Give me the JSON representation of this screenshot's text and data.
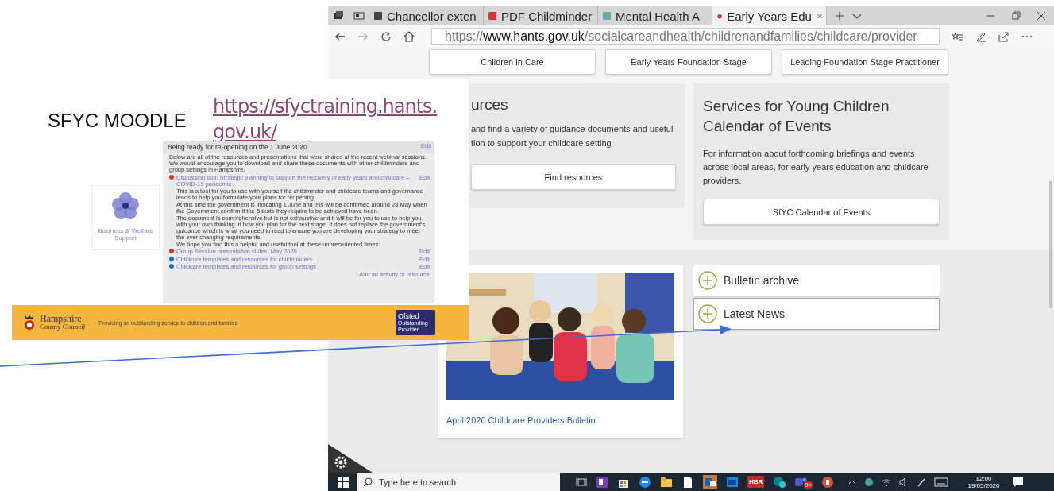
{
  "browser": {
    "tabs": [
      {
        "title": "Chancellor exten",
        "kind": "doc",
        "selected": false
      },
      {
        "title": "PDF Childminder",
        "kind": "pdf",
        "selected": false
      },
      {
        "title": "Mental Health A",
        "kind": "site",
        "selected": false
      },
      {
        "title": "Early Years Edu",
        "kind": "council",
        "selected": true
      }
    ],
    "url": {
      "scheme": "https://",
      "host": "www.hants.gov.uk",
      "path": "/socialcareandhealth/childrenandfamilies/childcare/provider"
    }
  },
  "page": {
    "nav_buttons": [
      "Children in Care",
      "Early Years Foundation Stage",
      "Leading Foundation Stage Practitioner"
    ],
    "resources_card": {
      "heading": "urces",
      "text": [
        "and find a variety of guidance documents and useful",
        "tion to support your childcare setting"
      ],
      "button": "Find resources"
    },
    "events_card": {
      "heading": "Services for Young Children Calendar of Events",
      "text": "For information about forthcoming briefings and events across local areas, for early years education and childcare providers.",
      "button": "SfYC Calendar of Events"
    },
    "bulletin_card": {
      "caption": "April 2020 Childcare Providers Bulletin"
    },
    "accordion": [
      {
        "label": "Bulletin archive",
        "selected": false
      },
      {
        "label": "Latest News",
        "selected": true
      }
    ]
  },
  "taskbar": {
    "search_placeholder": "Type here to search",
    "hbr_label": "HBR",
    "teams_badge": "9+",
    "time": "12:00",
    "date": "19/05/2020"
  },
  "slide": {
    "title": "SFYC MOODLE",
    "link": "https://sfyctraining.hants.gov.uk/",
    "tile_label": "Business & Welfare Support",
    "moodle": {
      "section_title": "Being ready for re-opening on the 1 June 2020",
      "edit": "Edit",
      "intro": "Below are all of the resources and presentations that were shared at the recent webinar sessions. We would encourage you to download and share these documents with other childminders and group settings in Hampshire.",
      "items": [
        {
          "title": "Discussion tool: Strategic planning to support the recovery of early years and childcare – COVID-19 pandemic",
          "color": "#d9342b",
          "edit": "Edit",
          "description": [
            "This is a tool for you to use with yourself if a childminder and childcare teams and governance leads to help you formulate your plans for reopening.",
            "At this time the government is indicating 1 June and this will be confirmed around 28 May when the Government confirm if the 5 tests they require to be achieved have been.",
            "The document is comprehensive but is not exhaustive and  it will be for you to use to help you with your own thinking in how you plan for the next stage.  It does not replace the government's guidance which is what you need to read to ensure you are developing your strategy to meet the ever changing requirements.",
            "We hope you find this a helpful and useful tool at these unprecedented times."
          ]
        },
        {
          "title": "Group Session presentation slides- May 2020",
          "color": "#d9342b",
          "edit": "Edit"
        },
        {
          "title": "Childcare templates and resources for childminders",
          "color": "#1f6fc4",
          "edit": "Edit"
        },
        {
          "title": "Childcare templates and resources for group settings",
          "color": "#1f6fc4",
          "edit": "Edit"
        }
      ],
      "add_link": "Add an activity or resource"
    },
    "banner": {
      "org_name": "Hampshire",
      "org_sub": "County Council",
      "tagline": "Providing an outstanding service to children and families",
      "badge_title": "Ofsted",
      "badge_sub": "Outstanding Provider"
    }
  }
}
